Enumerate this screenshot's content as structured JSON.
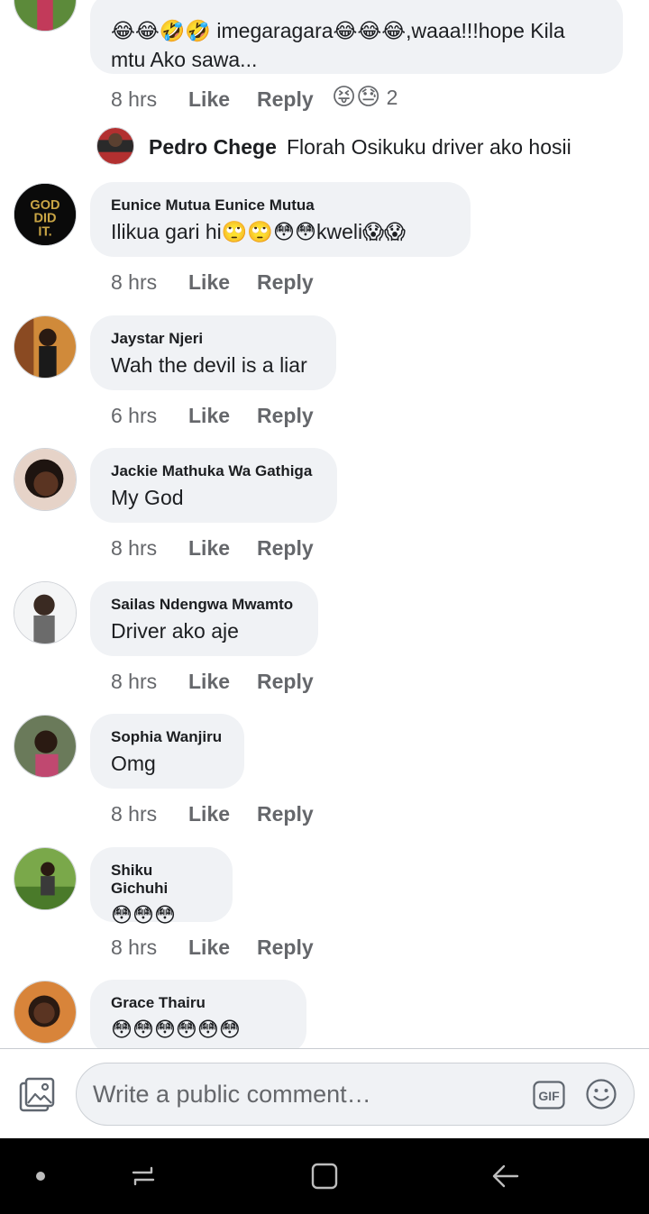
{
  "comments_partial_top": {
    "text": "😂😂🤣🤣 imegaragara😂😂😂,waaa!!!hope Kila mtu Ako sawa...",
    "time": "8 hrs",
    "like": "Like",
    "reply": "Reply",
    "reactions_emoji": "😝😓",
    "reactions_count": "2"
  },
  "reply_preview": {
    "name": "Pedro Chege",
    "text": "Florah Osikuku driver ako hosii"
  },
  "comments": [
    {
      "name": "Eunice Mutua Eunice Mutua",
      "text": "Ilikua gari hi🙄🙄😳😳kweli😱😱",
      "time": "8 hrs",
      "like": "Like",
      "reply": "Reply"
    },
    {
      "name": "Jaystar Njeri",
      "text": "Wah the devil is a liar",
      "time": "6 hrs",
      "like": "Like",
      "reply": "Reply"
    },
    {
      "name": "Jackie Mathuka Wa Gathiga",
      "text": "My God",
      "time": "8 hrs",
      "like": "Like",
      "reply": "Reply"
    },
    {
      "name": "Sailas Ndengwa Mwamto",
      "text": "Driver ako aje",
      "time": "8 hrs",
      "like": "Like",
      "reply": "Reply"
    },
    {
      "name": "Sophia Wanjiru",
      "text": "Omg",
      "time": "8 hrs",
      "like": "Like",
      "reply": "Reply"
    },
    {
      "name": "Shiku Gichuhi",
      "text": "😳😳😳",
      "time": "8 hrs",
      "like": "Like",
      "reply": "Reply"
    },
    {
      "name": "Grace Thairu",
      "text": "😳😳😳😳😳😳"
    }
  ],
  "avatar_logo_text": [
    "GOD",
    "DID",
    "IT."
  ],
  "composer": {
    "placeholder": "Write a public comment…",
    "gif_label": "GIF"
  },
  "icons": {
    "photo": "photo-icon",
    "gif": "gif-icon",
    "emoji": "smiley-icon",
    "nav_dot": "dot-icon",
    "nav_recent": "recent-apps-icon",
    "nav_home": "home-icon",
    "nav_back": "back-icon"
  },
  "colors": {
    "bubble_bg": "#f0f2f5",
    "meta_text": "#65676b",
    "nav_bg": "#000000"
  }
}
